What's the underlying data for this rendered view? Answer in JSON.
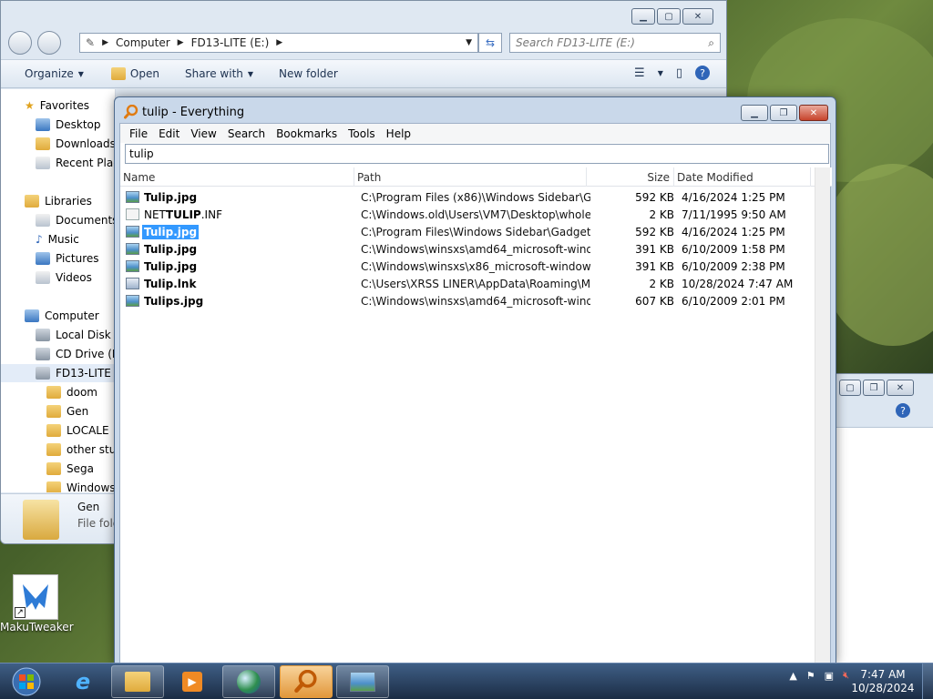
{
  "explorer": {
    "address": {
      "crumbs": [
        "Computer",
        "FD13-LITE (E:)"
      ]
    },
    "search_placeholder": "Search FD13-LITE (E:)",
    "toolbar": {
      "organize": "Organize",
      "open": "Open",
      "share_with": "Share with",
      "new_folder": "New folder"
    },
    "nav": {
      "favorites": "Favorites",
      "desktop": "Desktop",
      "downloads": "Downloads",
      "recent": "Recent Places",
      "libraries": "Libraries",
      "documents": "Documents",
      "music": "Music",
      "pictures": "Pictures",
      "videos": "Videos",
      "computer": "Computer",
      "local_disk": "Local Disk (C:)",
      "cd_drive": "CD Drive (D:)",
      "fd13": "FD13-LITE (E:)",
      "doom": "doom",
      "gen": "Gen",
      "locale": "LOCALE",
      "other": "other stuff",
      "sega": "Sega",
      "windows": "Windows"
    },
    "details": {
      "name": "Gen",
      "type": "File folder"
    }
  },
  "everything": {
    "title": "tulip - Everything",
    "menu": [
      "File",
      "Edit",
      "View",
      "Search",
      "Bookmarks",
      "Tools",
      "Help"
    ],
    "search_value": "tulip",
    "columns": {
      "name": "Name",
      "path": "Path",
      "size": "Size",
      "date": "Date Modified"
    },
    "rows": [
      {
        "pre": "",
        "hl": "Tulip",
        "post": ".jpg",
        "path": "C:\\Program Files (x86)\\Windows Sidebar\\Gad...",
        "size": "592 KB",
        "date": "4/16/2024 1:25 PM",
        "icon": "jpg"
      },
      {
        "pre": "NET",
        "hl": "TULIP",
        "post": ".INF",
        "path": "C:\\Windows.old\\Users\\VM7\\Desktop\\wholeu...",
        "size": "2 KB",
        "date": "7/11/1995 9:50 AM",
        "icon": "inf"
      },
      {
        "pre": "",
        "hl": "Tulip",
        "post": ".jpg",
        "path": "C:\\Program Files\\Windows Sidebar\\Gadgets\\...",
        "size": "592 KB",
        "date": "4/16/2024 1:25 PM",
        "icon": "jpg"
      },
      {
        "pre": "",
        "hl": "Tulip",
        "post": ".jpg",
        "path": "C:\\Windows\\winsxs\\amd64_microsoft-windo...",
        "size": "391 KB",
        "date": "6/10/2009 1:58 PM",
        "icon": "jpg"
      },
      {
        "pre": "",
        "hl": "Tulip",
        "post": ".jpg",
        "path": "C:\\Windows\\winsxs\\x86_microsoft-windows-...",
        "size": "391 KB",
        "date": "6/10/2009 2:38 PM",
        "icon": "jpg"
      },
      {
        "pre": "",
        "hl": "Tulip",
        "post": ".lnk",
        "path": "C:\\Users\\XRSS LINER\\AppData\\Roaming\\Mic...",
        "size": "2 KB",
        "date": "10/28/2024 7:47 AM",
        "icon": "lnk"
      },
      {
        "pre": "",
        "hl": "Tulips",
        "post": ".jpg",
        "path": "C:\\Windows\\winsxs\\amd64_microsoft-windo...",
        "size": "607 KB",
        "date": "6/10/2009 2:01 PM",
        "icon": "jpg"
      }
    ],
    "selected_row": 2
  },
  "desktop": {
    "icon_label": "MakuTweaker"
  },
  "taskbar": {
    "time": "7:47 AM",
    "date": "10/28/2024"
  },
  "colors": {
    "selection": "#3399ff",
    "taskbar": "#1b2c44",
    "active_task": "#e2983c"
  }
}
